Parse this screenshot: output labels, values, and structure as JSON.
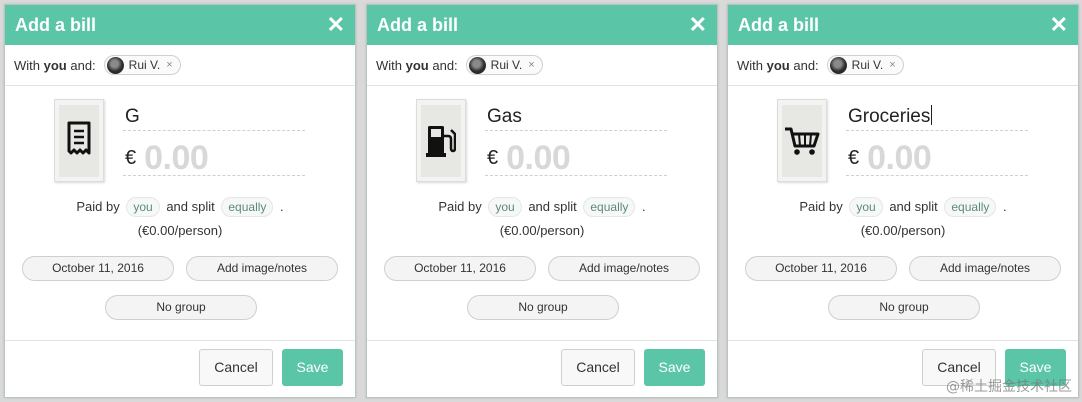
{
  "dialogs": [
    {
      "title": "Add a bill",
      "close_glyph": "✕",
      "with_prefix": "With ",
      "with_you": "you",
      "with_suffix": " and:",
      "participant": "Rui V.",
      "participant_remove": "×",
      "category_icon": "receipt-icon",
      "description": "G",
      "currency": "€",
      "amount_placeholder": "0.00",
      "paid_by_prefix": "Paid by",
      "paid_by": "you",
      "split_prefix": "and split",
      "split": "equally",
      "split_suffix": ".",
      "per_person": "(€0.00/person)",
      "date": "October 11, 2016",
      "notes": "Add image/notes",
      "group": "No group",
      "cancel": "Cancel",
      "save": "Save"
    },
    {
      "title": "Add a bill",
      "close_glyph": "✕",
      "with_prefix": "With ",
      "with_you": "you",
      "with_suffix": " and:",
      "participant": "Rui V.",
      "participant_remove": "×",
      "category_icon": "gas-pump-icon",
      "description": "Gas",
      "currency": "€",
      "amount_placeholder": "0.00",
      "paid_by_prefix": "Paid by",
      "paid_by": "you",
      "split_prefix": "and split",
      "split": "equally",
      "split_suffix": ".",
      "per_person": "(€0.00/person)",
      "date": "October 11, 2016",
      "notes": "Add image/notes",
      "group": "No group",
      "cancel": "Cancel",
      "save": "Save"
    },
    {
      "title": "Add a bill",
      "close_glyph": "✕",
      "with_prefix": "With ",
      "with_you": "you",
      "with_suffix": " and:",
      "participant": "Rui V.",
      "participant_remove": "×",
      "category_icon": "shopping-cart-icon",
      "description": "Groceries",
      "currency": "€",
      "amount_placeholder": "0.00",
      "paid_by_prefix": "Paid by",
      "paid_by": "you",
      "split_prefix": "and split",
      "split": "equally",
      "split_suffix": ".",
      "per_person": "(€0.00/person)",
      "date": "October 11, 2016",
      "notes": "Add image/notes",
      "group": "No group",
      "cancel": "Cancel",
      "save": "Save"
    }
  ],
  "watermark": "@稀土掘金技术社区",
  "colors": {
    "accent": "#5bc5a7",
    "placeholder": "#d8d8d8"
  }
}
